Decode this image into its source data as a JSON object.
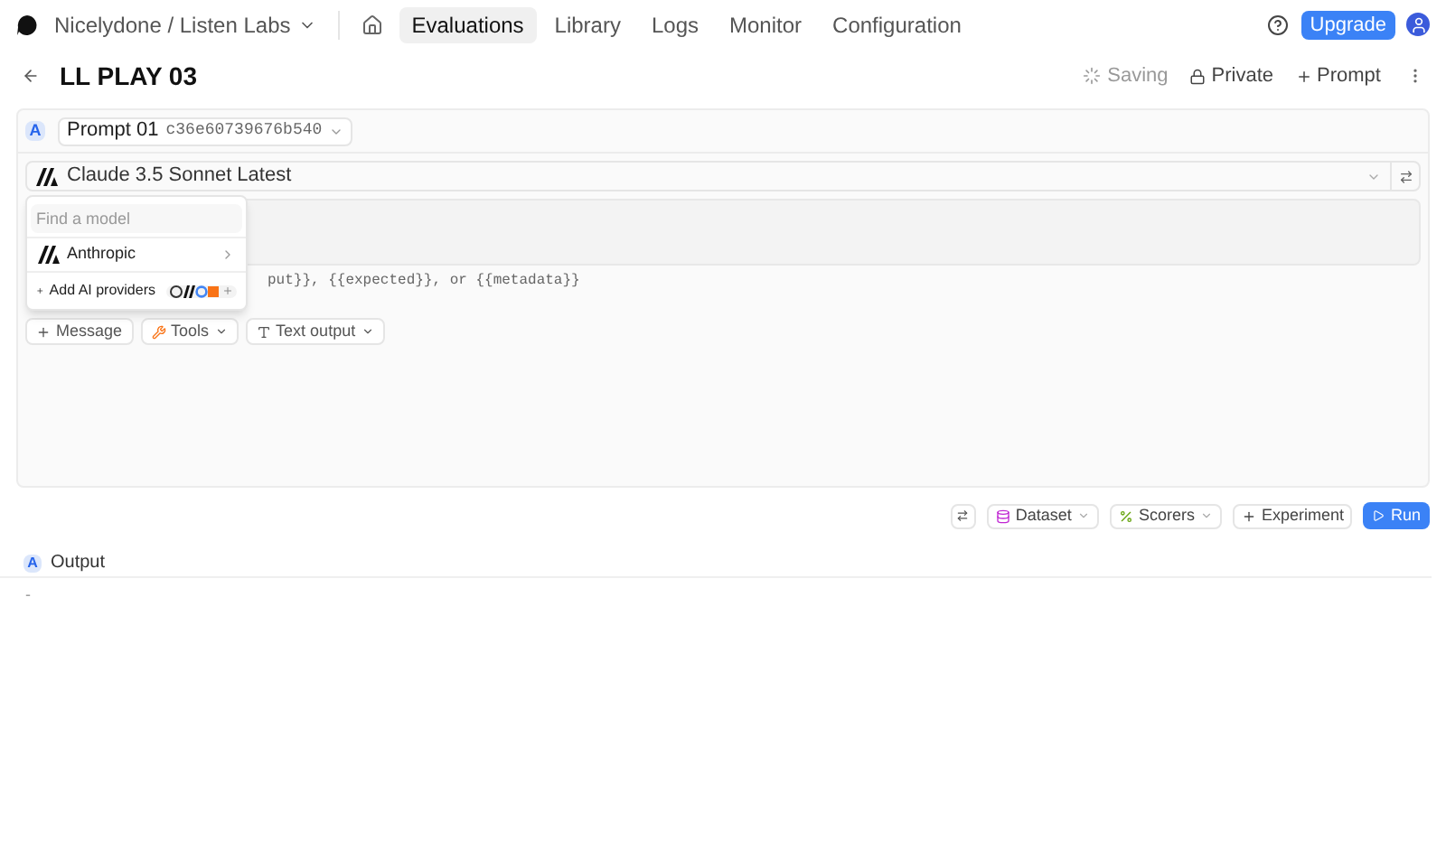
{
  "nav": {
    "org": "Nicelydone / Listen Labs",
    "tabs": [
      {
        "label": "Evaluations",
        "selected": true
      },
      {
        "label": "Library",
        "selected": false
      },
      {
        "label": "Logs",
        "selected": false
      },
      {
        "label": "Monitor",
        "selected": false
      },
      {
        "label": "Configuration",
        "selected": false
      }
    ],
    "upgrade": "Upgrade"
  },
  "page": {
    "title": "LL PLAY 03",
    "saving": "Saving",
    "private": "Private",
    "prompt": "Prompt"
  },
  "prompt": {
    "badge": "A",
    "name": "Prompt 01",
    "id": "c36e60739676b540",
    "model": "Claude 3.5 Sonnet Latest",
    "hint": "put}}, {{expected}}, or {{metadata}}",
    "buttons": [
      "Message",
      "Tools",
      "Text output"
    ]
  },
  "model_menu": {
    "placeholder": "Find a model",
    "provider": "Anthropic",
    "add": "Add AI providers"
  },
  "actions": {
    "dataset": "Dataset",
    "scorers": "Scorers",
    "experiment": "Experiment",
    "run": "Run"
  },
  "output": {
    "badge": "A",
    "title": "Output",
    "value": "-"
  }
}
